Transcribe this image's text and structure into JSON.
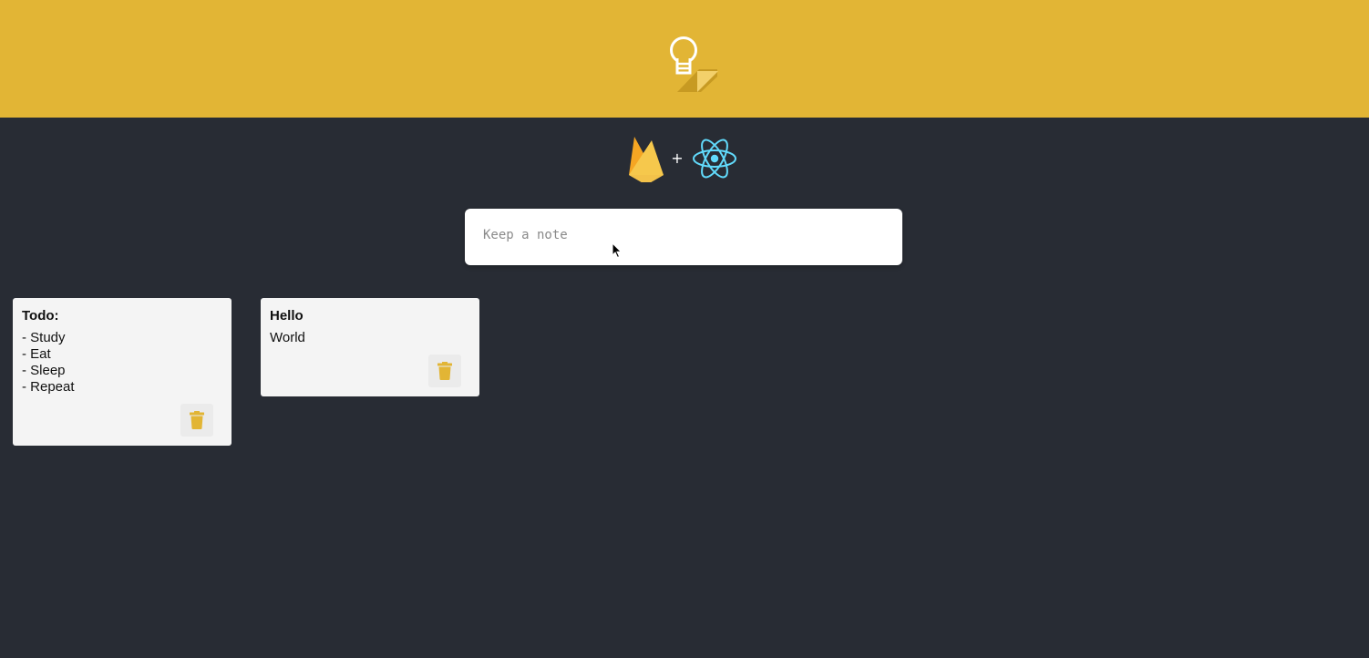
{
  "header": {
    "logo_icon": "lightbulb-sticky-note-icon",
    "accent": "#e2b535"
  },
  "tech": {
    "left_icon": "firebase-icon",
    "separator": "+",
    "right_icon": "react-icon"
  },
  "note_input": {
    "placeholder": "Keep a note",
    "value": ""
  },
  "notes": [
    {
      "title": "Todo:",
      "content": "- Study\n- Eat\n- Sleep\n- Repeat",
      "delete_icon": "trash-icon"
    },
    {
      "title": "Hello",
      "content": "World",
      "delete_icon": "trash-icon"
    }
  ],
  "colors": {
    "background": "#282c34",
    "card": "#f4f4f4",
    "accent": "#e2b535"
  }
}
